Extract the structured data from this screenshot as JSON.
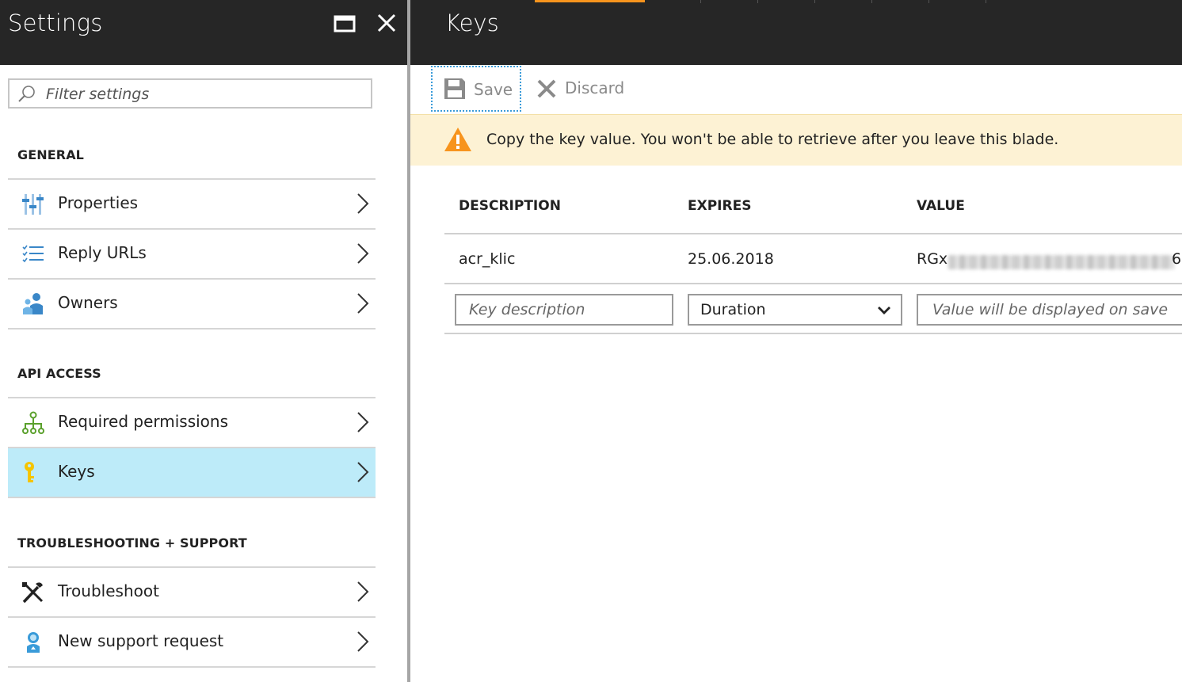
{
  "settings_blade": {
    "title": "Settings",
    "filter": {
      "placeholder": "Filter settings",
      "value": ""
    },
    "sections": [
      {
        "header": "GENERAL",
        "items": [
          {
            "label": "Properties",
            "icon": "properties-icon"
          },
          {
            "label": "Reply URLs",
            "icon": "reply-urls-icon"
          },
          {
            "label": "Owners",
            "icon": "owners-icon"
          }
        ]
      },
      {
        "header": "API ACCESS",
        "items": [
          {
            "label": "Required permissions",
            "icon": "permissions-icon"
          },
          {
            "label": "Keys",
            "icon": "key-icon",
            "selected": true
          }
        ]
      },
      {
        "header": "TROUBLESHOOTING + SUPPORT",
        "items": [
          {
            "label": "Troubleshoot",
            "icon": "wrench-icon"
          },
          {
            "label": "New support request",
            "icon": "support-icon"
          }
        ]
      }
    ]
  },
  "keys_blade": {
    "title": "Keys",
    "toolbar": {
      "save_label": "Save",
      "discard_label": "Discard"
    },
    "warning": "Copy the key value. You won't be able to retrieve after you leave this blade.",
    "table": {
      "columns": [
        "DESCRIPTION",
        "EXPIRES",
        "VALUE"
      ],
      "rows": [
        {
          "description": "acr_klic",
          "expires": "25.06.2018",
          "value_prefix": "RGx",
          "value_suffix": "6"
        }
      ],
      "new_key": {
        "description_placeholder": "Key description",
        "duration": "Duration",
        "value_placeholder": "Value will be displayed on save"
      }
    }
  },
  "colors": {
    "header_bg": "#262626",
    "accent": "#f7941d",
    "selected_bg": "#bdebf9",
    "warning_bg": "#fdf2d4",
    "warning_icon": "#f7941d"
  }
}
